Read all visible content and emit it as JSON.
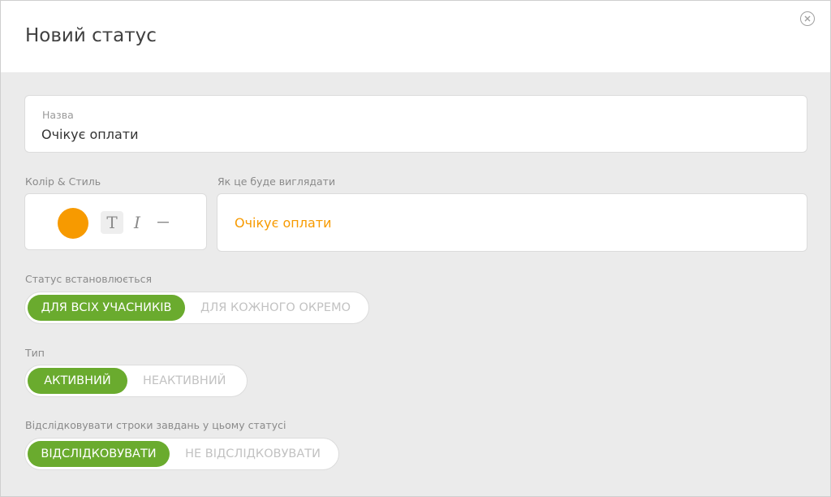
{
  "dialog": {
    "title": "Новий статус",
    "close_icon": "close-circle-icon"
  },
  "name_field": {
    "label": "Назва",
    "value": "Очікує оплати"
  },
  "style": {
    "label": "Колір & Стиль",
    "color": "#f79a00",
    "buttons": {
      "normal": "T",
      "italic": "I",
      "strike": "—"
    }
  },
  "preview": {
    "label": "Як це буде виглядати",
    "text": "Очікує оплати",
    "color": "#f79a00"
  },
  "assignment": {
    "label": "Статус встановлюється",
    "options": [
      "ДЛЯ ВСІХ УЧАСНИКІВ",
      "ДЛЯ КОЖНОГО ОКРЕМО"
    ],
    "selected": 0
  },
  "type": {
    "label": "Тип",
    "options": [
      "АКТИВНИЙ",
      "НЕАКТИВНИЙ"
    ],
    "selected": 0
  },
  "tracking": {
    "label": "Відслідковувати строки завдань у цьому статусі",
    "options": [
      "ВІДСЛІДКОВУВАТИ",
      "НЕ ВІДСЛІДКОВУВАТИ"
    ],
    "selected": 0
  },
  "colors": {
    "accent_green": "#6aab2e",
    "accent_orange": "#f79a00"
  }
}
